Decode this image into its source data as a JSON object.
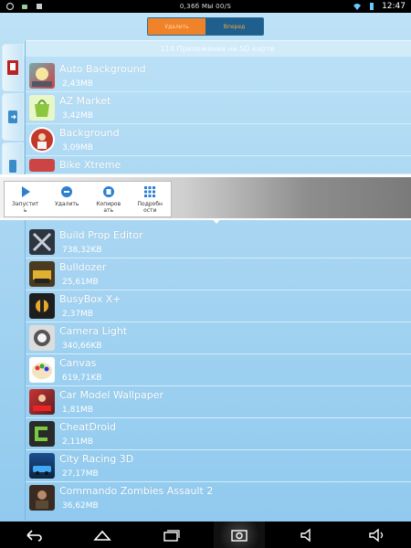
{
  "statusbar": {
    "center": "0,36б МЫ 00/S",
    "time": "12:47"
  },
  "toggle": {
    "left": "Удалить",
    "right": "Вперед"
  },
  "header": "114 Приложения на SD карте",
  "apps_above": [
    {
      "name": "Auto Background",
      "size": "2,43MB",
      "icon": "auto-background-icon"
    },
    {
      "name": "AZ Market",
      "size": "3,42MB",
      "icon": "az-market-icon"
    },
    {
      "name": "Background",
      "size": "3,09MB",
      "icon": "background-icon"
    },
    {
      "name": "Bike Xtreme",
      "size": "",
      "icon": "bike-xtreme-icon"
    }
  ],
  "apps_below": [
    {
      "name": "Build Prop Editor",
      "size": "738,32KB",
      "icon": "build-prop-editor-icon"
    },
    {
      "name": "Bulldozer",
      "size": "25,61MB",
      "icon": "bulldozer-icon"
    },
    {
      "name": "BusyBox X+",
      "size": "2,37MB",
      "icon": "busybox-icon"
    },
    {
      "name": "Camera Light",
      "size": "340,66KB",
      "icon": "camera-light-icon"
    },
    {
      "name": "Canvas",
      "size": "619,71KB",
      "icon": "canvas-icon"
    },
    {
      "name": "Car Model Wallpaper",
      "size": "1,81MB",
      "icon": "car-model-wallpaper-icon"
    },
    {
      "name": "CheatDroid",
      "size": "2,11MB",
      "icon": "cheatdroid-icon"
    },
    {
      "name": "City Racing 3D",
      "size": "27,17MB",
      "icon": "city-racing-icon"
    },
    {
      "name": "Commando Zombies Assault 2",
      "size": "36,62MB",
      "icon": "commando-zombies-icon"
    }
  ],
  "popup": {
    "run": "Запустит\nь",
    "delete": "Удалить",
    "copy": "Копиров\nать",
    "details": "Подробн\nости"
  },
  "colors": {
    "accent": "#f0832a",
    "header_blue": "#1f5f8d",
    "list_bg": "#a9d6f2"
  }
}
